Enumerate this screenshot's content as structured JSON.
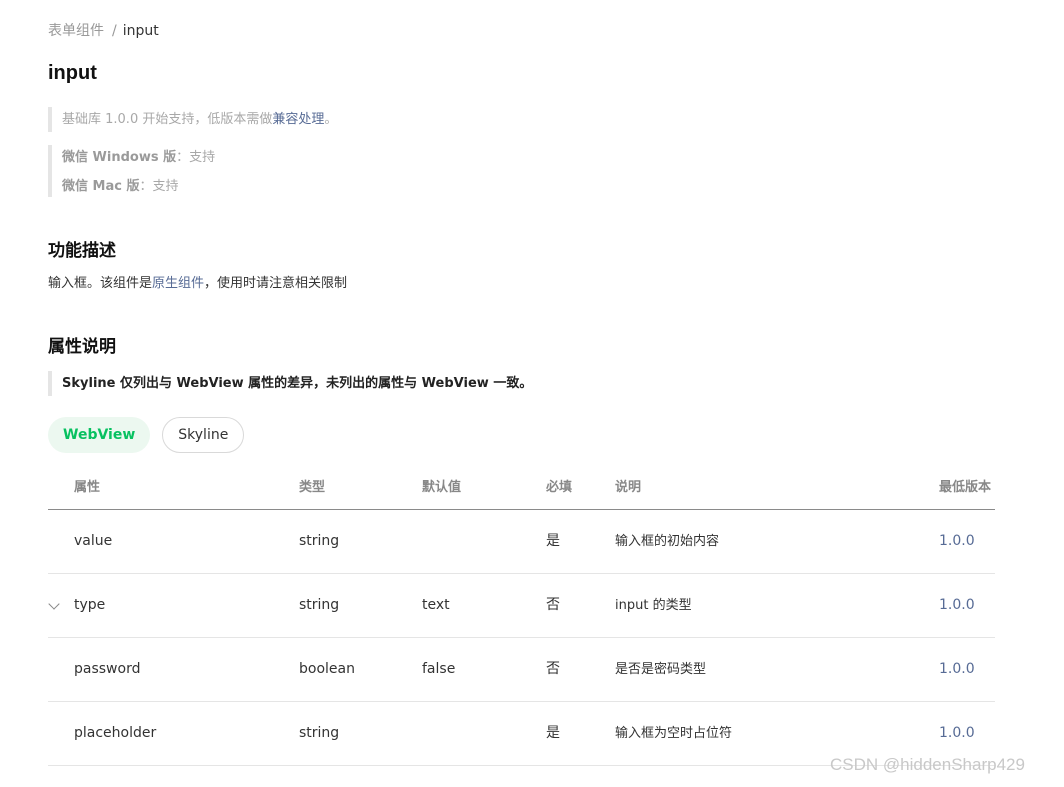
{
  "breadcrumb": {
    "parent": "表单组件",
    "separator": "/",
    "current": "input"
  },
  "title": "input",
  "notes": {
    "support_prefix": "基础库 1.0.0 开始支持，低版本需做",
    "support_link": "兼容处理",
    "support_suffix": "。",
    "windows_label": "微信 Windows 版",
    "windows_value": "：支持",
    "mac_label": "微信 Mac 版",
    "mac_value": "：支持"
  },
  "function": {
    "heading": "功能描述",
    "desc_prefix": "输入框。该组件是",
    "desc_link": "原生组件",
    "desc_suffix": "，使用时请注意相关限制"
  },
  "attributes": {
    "heading": "属性说明",
    "tip": "Skyline 仅列出与 WebView 属性的差异，未列出的属性与 WebView 一致。",
    "tabs": [
      {
        "label": "WebView",
        "active": true
      },
      {
        "label": "Skyline",
        "active": false
      }
    ],
    "columns": [
      "属性",
      "类型",
      "默认值",
      "必填",
      "说明",
      "最低版本"
    ],
    "rows": [
      {
        "name": "value",
        "type": "string",
        "default": "",
        "required": "是",
        "desc": "输入框的初始内容",
        "version": "1.0.0",
        "expandable": false
      },
      {
        "name": "type",
        "type": "string",
        "default": "text",
        "required": "否",
        "desc": "input 的类型",
        "version": "1.0.0",
        "expandable": true
      },
      {
        "name": "password",
        "type": "boolean",
        "default": "false",
        "required": "否",
        "desc": "是否是密码类型",
        "version": "1.0.0",
        "expandable": false
      },
      {
        "name": "placeholder",
        "type": "string",
        "default": "",
        "required": "是",
        "desc": "输入框为空时占位符",
        "version": "1.0.0",
        "expandable": false
      }
    ]
  },
  "colors": {
    "accent": "#07c160",
    "link": "#576b95",
    "muted": "#a8a8a8"
  },
  "watermark": "CSDN @hiddenSharp429"
}
